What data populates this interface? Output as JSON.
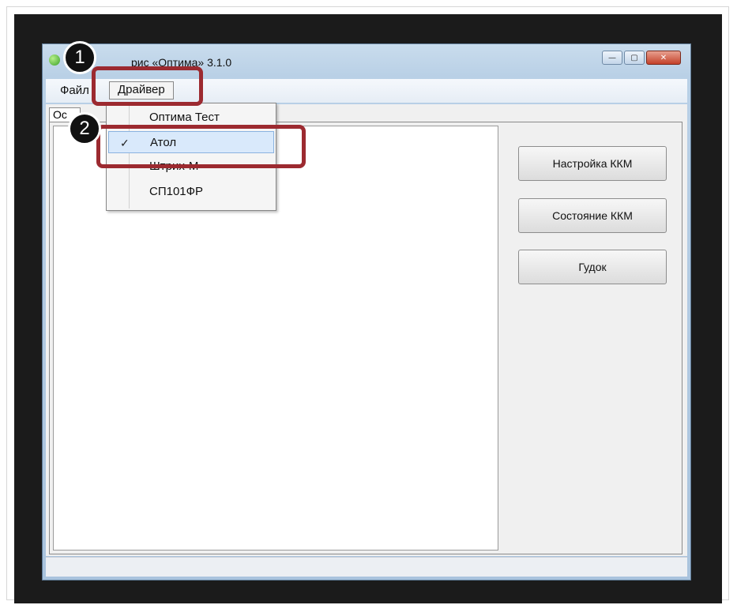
{
  "window": {
    "title": "рис «Оптима» 3.1.0",
    "controls": {
      "minimize": "—",
      "maximize": "▢",
      "close": "✕"
    }
  },
  "menu": {
    "file": "Файл",
    "driver": "Драйвер"
  },
  "tab": {
    "label": "Ос"
  },
  "dropdown": {
    "items": [
      {
        "label": "Оптима Тест",
        "checked": false
      },
      {
        "label": "Атол",
        "checked": true
      },
      {
        "label": "Штрих-М",
        "checked": false
      },
      {
        "label": "СП101ФР",
        "checked": false
      }
    ],
    "check_glyph": "✓"
  },
  "buttons": {
    "kkm_settings": "Настройка ККМ",
    "kkm_status": "Состояние ККМ",
    "beep": "Гудок"
  },
  "callouts": {
    "step1": "1",
    "step2": "2",
    "color": "#9c2a30"
  }
}
